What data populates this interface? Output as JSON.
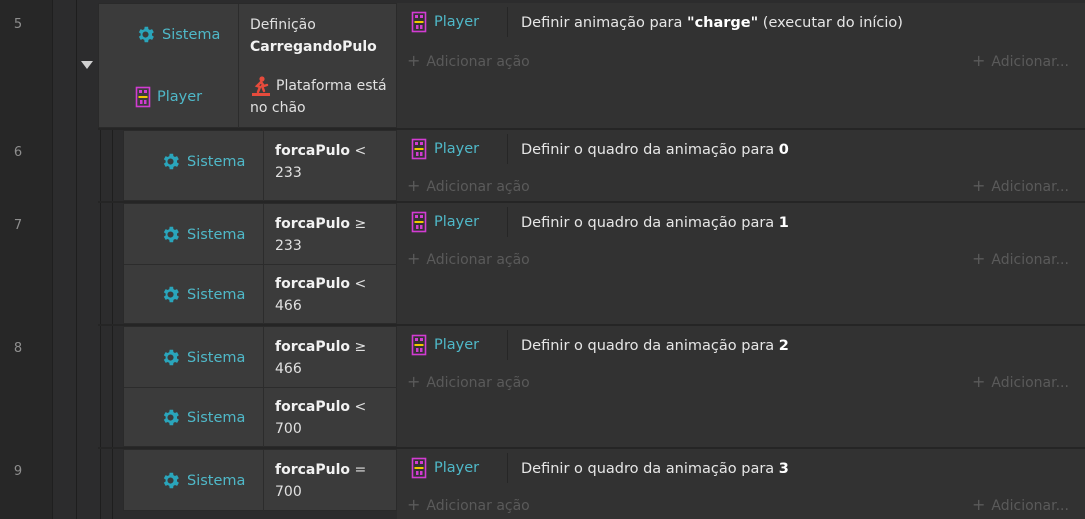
{
  "colors": {
    "accent": "#4fb8c8",
    "player_icon": "#c832c8",
    "platform_icon": "#e64b3c"
  },
  "labels": {
    "sistema": "Sistema",
    "player": "Player",
    "add_action": "Adicionar ação",
    "add_other": "Adicionar..."
  },
  "events": [
    {
      "line": "5",
      "conditions": [
        {
          "object": "Sistema",
          "icon": "gear-icon",
          "line1_plain": "Definição",
          "line2_bold": "CarregandoPulo"
        },
        {
          "object": "Player",
          "icon": "player-sprite-icon",
          "platform_text": "Plataforma está",
          "line2": "no chão"
        }
      ],
      "action": {
        "object": "Player",
        "text_prefix": "Definir animação para ",
        "text_bold": "\"charge\"",
        "text_suffix": " (executar do início)"
      }
    },
    {
      "line": "6",
      "conditions": [
        {
          "object": "Sistema",
          "var": "forcaPulo",
          "op": "<",
          "value": "233"
        }
      ],
      "action": {
        "object": "Player",
        "text_prefix": "Definir o quadro da animação para ",
        "text_bold": "0"
      }
    },
    {
      "line": "7",
      "conditions": [
        {
          "object": "Sistema",
          "var": "forcaPulo",
          "op": "≥",
          "value": "233"
        },
        {
          "object": "Sistema",
          "var": "forcaPulo",
          "op": "<",
          "value": "466"
        }
      ],
      "action": {
        "object": "Player",
        "text_prefix": "Definir o quadro da animação para ",
        "text_bold": "1"
      }
    },
    {
      "line": "8",
      "conditions": [
        {
          "object": "Sistema",
          "var": "forcaPulo",
          "op": "≥",
          "value": "466"
        },
        {
          "object": "Sistema",
          "var": "forcaPulo",
          "op": "<",
          "value": "700"
        }
      ],
      "action": {
        "object": "Player",
        "text_prefix": "Definir o quadro da animação para ",
        "text_bold": "2"
      }
    },
    {
      "line": "9",
      "conditions": [
        {
          "object": "Sistema",
          "var": "forcaPulo",
          "op": "=",
          "value": "700"
        }
      ],
      "action": {
        "object": "Player",
        "text_prefix": "Definir o quadro da animação para ",
        "text_bold": "3"
      }
    }
  ]
}
